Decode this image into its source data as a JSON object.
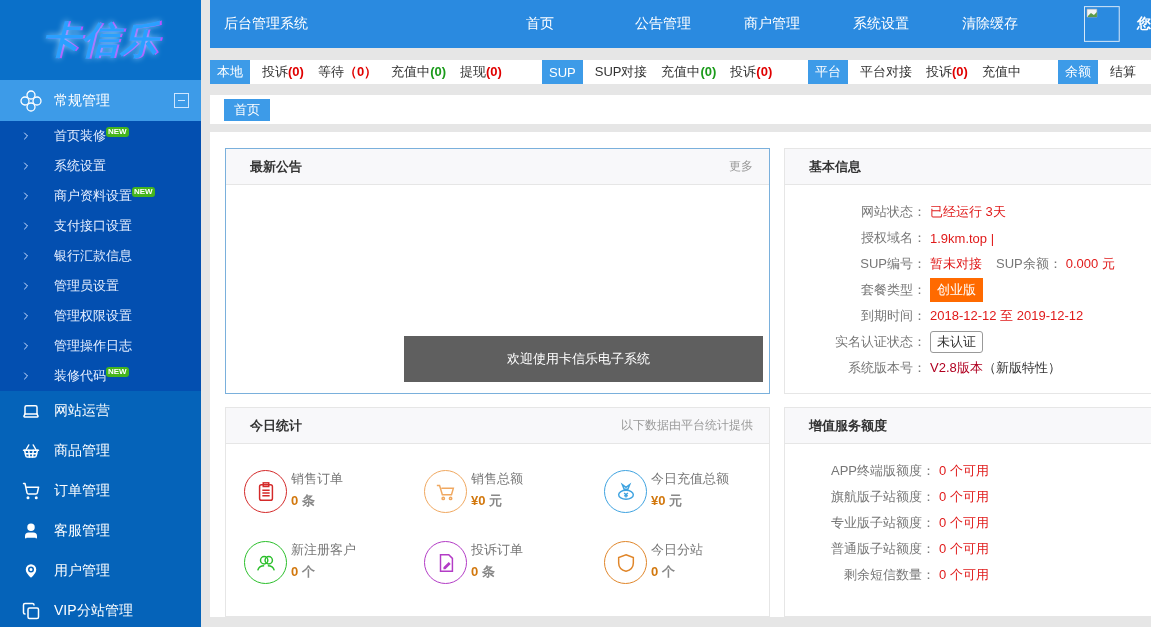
{
  "sidebar": {
    "logo": "卡信乐",
    "groups": [
      {
        "label": "常规管理",
        "expanded": true,
        "selected": true,
        "children": [
          {
            "label": "首页装修",
            "badge": "NEW"
          },
          {
            "label": "系统设置"
          },
          {
            "label": "商户资料设置",
            "badge": "NEW"
          },
          {
            "label": "支付接口设置"
          },
          {
            "label": "银行汇款信息"
          },
          {
            "label": "管理员设置"
          },
          {
            "label": "管理权限设置"
          },
          {
            "label": "管理操作日志"
          },
          {
            "label": "装修代码",
            "badge": "NEW"
          }
        ]
      },
      {
        "label": "网站运营",
        "selected": false
      },
      {
        "label": "商品管理",
        "selected": false
      },
      {
        "label": "订单管理",
        "selected": false
      },
      {
        "label": "客服管理",
        "selected": false
      },
      {
        "label": "用户管理",
        "selected": false
      },
      {
        "label": "VIP分站管理",
        "selected": false
      }
    ]
  },
  "header": {
    "title": "后台管理系统",
    "nav": [
      "首页",
      "公告管理",
      "商户管理",
      "系统设置",
      "清除缓存"
    ],
    "greeting": "您"
  },
  "status_bar": [
    {
      "label": "本地",
      "items": [
        {
          "text": "投诉",
          "count": "(0)",
          "color": "#e00000"
        },
        {
          "text": "等待",
          "count": "（0）",
          "color": "#e00000"
        },
        {
          "text": "充值中",
          "count": "(0)",
          "color": "#1a9a1a"
        },
        {
          "text": "提现",
          "count": "(0)",
          "color": "#e00000"
        }
      ]
    },
    {
      "label": "SUP",
      "items": [
        {
          "text": "SUP对接"
        },
        {
          "text": "充值中",
          "count": "(0)",
          "color": "#1a9a1a"
        },
        {
          "text": "投诉",
          "count": "(0)",
          "color": "#e00000"
        }
      ]
    },
    {
      "label": "平台",
      "items": [
        {
          "text": "平台对接"
        },
        {
          "text": "投诉",
          "count": "(0)",
          "color": "#e00000"
        },
        {
          "text": "充值中"
        }
      ]
    },
    {
      "label": "余额",
      "items": [
        {
          "text": "结算"
        }
      ]
    }
  ],
  "breadcrumb": [
    "首页"
  ],
  "notice": {
    "title": "最新公告",
    "more": "更多"
  },
  "basic_info": {
    "title": "基本信息",
    "rows": [
      {
        "kind": "text",
        "label": "网站状态：",
        "value": "已经运行 3天"
      },
      {
        "kind": "text",
        "label": "授权域名：",
        "value": "1.9km.top |"
      },
      {
        "kind": "pair",
        "label": "SUP编号：",
        "value": "暂未对接",
        "label_2": "SUP余额：",
        "value_2": "0.000 元"
      },
      {
        "kind": "badge",
        "label": "套餐类型：",
        "value": "创业版"
      },
      {
        "kind": "text",
        "label": "到期时间：",
        "value": "2018-12-12 至 2019-12-12"
      },
      {
        "kind": "button",
        "label": "实名认证状态：",
        "value": "未认证"
      },
      {
        "kind": "version",
        "label": "系统版本号：",
        "value": "V2.8版本",
        "note": "（新版特性）"
      }
    ]
  },
  "today": {
    "title": "今日统计",
    "note": "以下数据由平台统计提供",
    "stats": [
      {
        "label": "销售订单",
        "value": "0",
        "unit": "条",
        "color": "#d42a2a"
      },
      {
        "label": "销售总额",
        "value": "¥0",
        "unit": "元",
        "color": "#f0a860"
      },
      {
        "label": "今日充值总额",
        "value": "¥0",
        "unit": "元",
        "color": "#3fa3e0"
      },
      {
        "label": "新注册客户",
        "value": "0",
        "unit": "个",
        "color": "#2bbf2b"
      },
      {
        "label": "投诉订单",
        "value": "0",
        "unit": "条",
        "color": "#b33cc6"
      },
      {
        "label": "今日分站",
        "value": "0",
        "unit": "个",
        "color": "#e0862a"
      }
    ]
  },
  "quota": {
    "title": "增值服务额度",
    "rows": [
      {
        "label": "APP终端版额度：",
        "value": "0 个可用"
      },
      {
        "label": "旗航版子站额度：",
        "value": "0 个可用"
      },
      {
        "label": "专业版子站额度：",
        "value": "0 个可用"
      },
      {
        "label": "普通版子站额度：",
        "value": "0 个可用"
      },
      {
        "label": "剩余短信数量：",
        "value": "0 个可用"
      }
    ]
  },
  "toast": "欢迎使用卡信乐电子系统"
}
